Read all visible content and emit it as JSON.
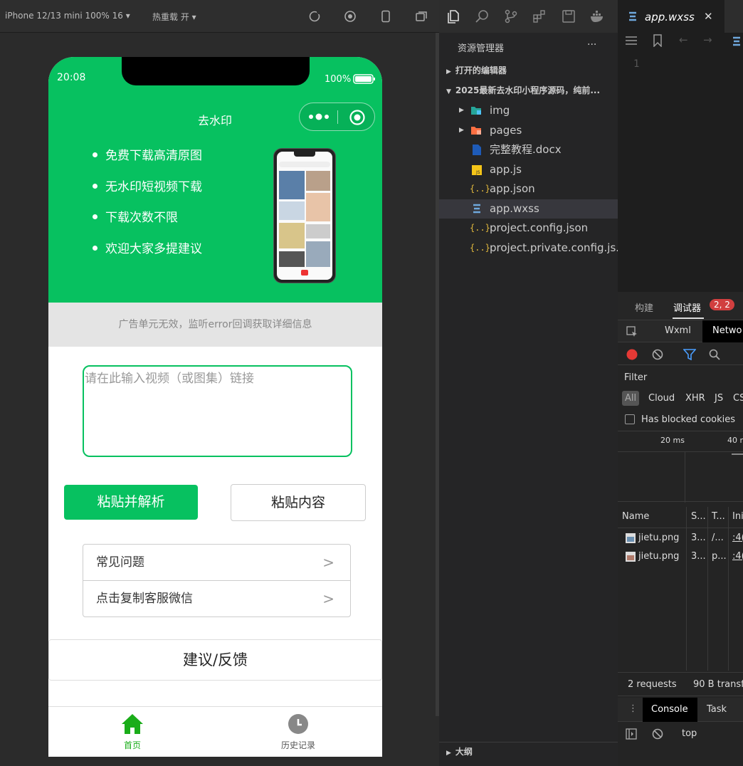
{
  "simulator": {
    "device": "iPhone 12/13 mini 100% 16 ▾",
    "hotreload": "热重载 开 ▾"
  },
  "phone": {
    "time": "20:08",
    "battery": "100%",
    "nav_title": "去水印",
    "features": [
      "免费下载高清原图",
      "无水印短视频下载",
      "下载次数不限",
      "欢迎大家多提建议"
    ],
    "ad_text": "广告单元无效，监听error回调获取详细信息",
    "input_placeholder": "请在此输入视频（或图集）链接",
    "parse_button": "粘贴并解析",
    "paste_button": "粘贴内容",
    "menu": [
      {
        "label": "常见问题",
        "arrow": ">"
      },
      {
        "label": "点击复制客服微信",
        "arrow": ">"
      }
    ],
    "feedback_button": "建议/反馈",
    "tabs": [
      {
        "label": "首页",
        "icon": "home-icon",
        "active": true
      },
      {
        "label": "历史记录",
        "icon": "clock-icon",
        "active": false
      }
    ],
    "accent": "#07c160"
  },
  "explorer": {
    "title": "资源管理器",
    "more": "···",
    "open_editors": "打开的编辑器",
    "project": "2025最新去水印小程序源码，纯前...",
    "files": [
      {
        "name": "img",
        "type": "folder"
      },
      {
        "name": "pages",
        "type": "folder"
      },
      {
        "name": "完整教程.docx",
        "type": "docx"
      },
      {
        "name": "app.js",
        "type": "js"
      },
      {
        "name": "app.json",
        "type": "json"
      },
      {
        "name": "app.wxss",
        "type": "css"
      },
      {
        "name": "project.config.json",
        "type": "json"
      },
      {
        "name": "project.private.config.js...",
        "type": "json"
      }
    ],
    "outline": "大纲"
  },
  "editor": {
    "tab": "app.wxss",
    "close": "✕",
    "line_number": "1"
  },
  "devtools": {
    "tab_build": "构建",
    "tab_debugger": "调试器",
    "badge": "2, 2",
    "wxml_tab": "Wxml",
    "network_tab": "Netwo",
    "filter_label": "Filter",
    "filter_types": [
      "All",
      "Cloud",
      "XHR",
      "JS",
      "CS"
    ],
    "blocked_cookies": "Has blocked cookies",
    "timeline": [
      "20 ms",
      "40 n"
    ],
    "columns": [
      "Name",
      "S...",
      "T...",
      "Ini"
    ],
    "rows": [
      {
        "name": "jietu.png",
        "status": "3...",
        "type": "/...",
        "init": ":4("
      },
      {
        "name": "jietu.png",
        "status": "3...",
        "type": "p...",
        "init": ":4("
      }
    ],
    "summary_requests": "2 requests",
    "summary_transfer": "90 B transf",
    "console_tab": "Console",
    "task_tab": "Task",
    "context": "top"
  }
}
